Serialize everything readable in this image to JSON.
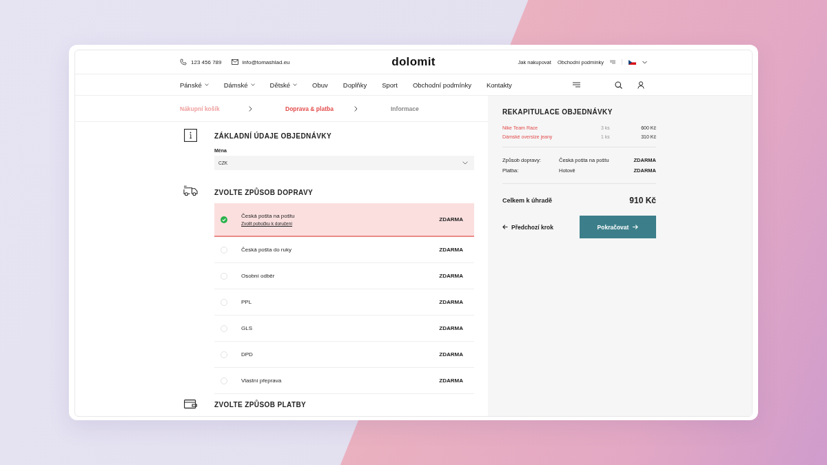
{
  "topbar": {
    "phone": "123 456 789",
    "email": "info@tomashlad.eu",
    "logo": "dolomit",
    "links": [
      "Jak nakupovat",
      "Obchodní podmínky"
    ]
  },
  "nav": {
    "items": [
      {
        "label": "Pánské",
        "dropdown": true
      },
      {
        "label": "Dámské",
        "dropdown": true
      },
      {
        "label": "Dětské",
        "dropdown": true
      },
      {
        "label": "Obuv",
        "dropdown": false
      },
      {
        "label": "Doplňky",
        "dropdown": false
      },
      {
        "label": "Sport",
        "dropdown": false
      },
      {
        "label": "Obchodní podmínky",
        "dropdown": false
      },
      {
        "label": "Kontakty",
        "dropdown": false
      }
    ]
  },
  "steps": [
    {
      "label": "Nákupní košík",
      "selected": false,
      "completed": true
    },
    {
      "label": "Doprava & platba",
      "selected": true,
      "completed": false
    },
    {
      "label": "Informace",
      "selected": false,
      "completed": false
    }
  ],
  "basic": {
    "title": "ZÁKLADNÍ ÚDAJE OBJEDNÁVKY",
    "currency_label": "Měna",
    "currency_value": "CZK"
  },
  "shipping": {
    "title": "ZVOLTE ZPŮSOB DOPRAVY",
    "options": [
      {
        "name": "Česká pošta na poštu",
        "link": "Zvolit pobočku k doručení",
        "price": "ZDARMA",
        "selected": true
      },
      {
        "name": "Česká pošta do ruky",
        "price": "ZDARMA",
        "selected": false
      },
      {
        "name": "Osobní odběr",
        "price": "ZDARMA",
        "selected": false
      },
      {
        "name": "PPL",
        "price": "ZDARMA",
        "selected": false
      },
      {
        "name": "GLS",
        "price": "ZDARMA",
        "selected": false
      },
      {
        "name": "DPD",
        "price": "ZDARMA",
        "selected": false
      },
      {
        "name": "Vlastní přeprava",
        "price": "ZDARMA",
        "selected": false
      }
    ]
  },
  "payment": {
    "title": "ZVOLTE ZPŮSOB PLATBY"
  },
  "summary": {
    "title": "REKAPITULACE OBJEDNÁVKY",
    "items": [
      {
        "name": "Nike Team Race",
        "qty": "3 ks",
        "price": "600 Kč"
      },
      {
        "name": "Dámské oversize jeany",
        "qty": "1 ks",
        "price": "310 Kč"
      }
    ],
    "details": [
      {
        "label": "Způsob dopravy:",
        "value": "Česká pošta na poštu",
        "price": "ZDARMA"
      },
      {
        "label": "Platba:",
        "value": "Hotově",
        "price": "ZDARMA"
      }
    ],
    "total_label": "Celkem k úhradě",
    "total": "910 Kč",
    "back": "Předchozí krok",
    "continue": "Pokračovat"
  }
}
